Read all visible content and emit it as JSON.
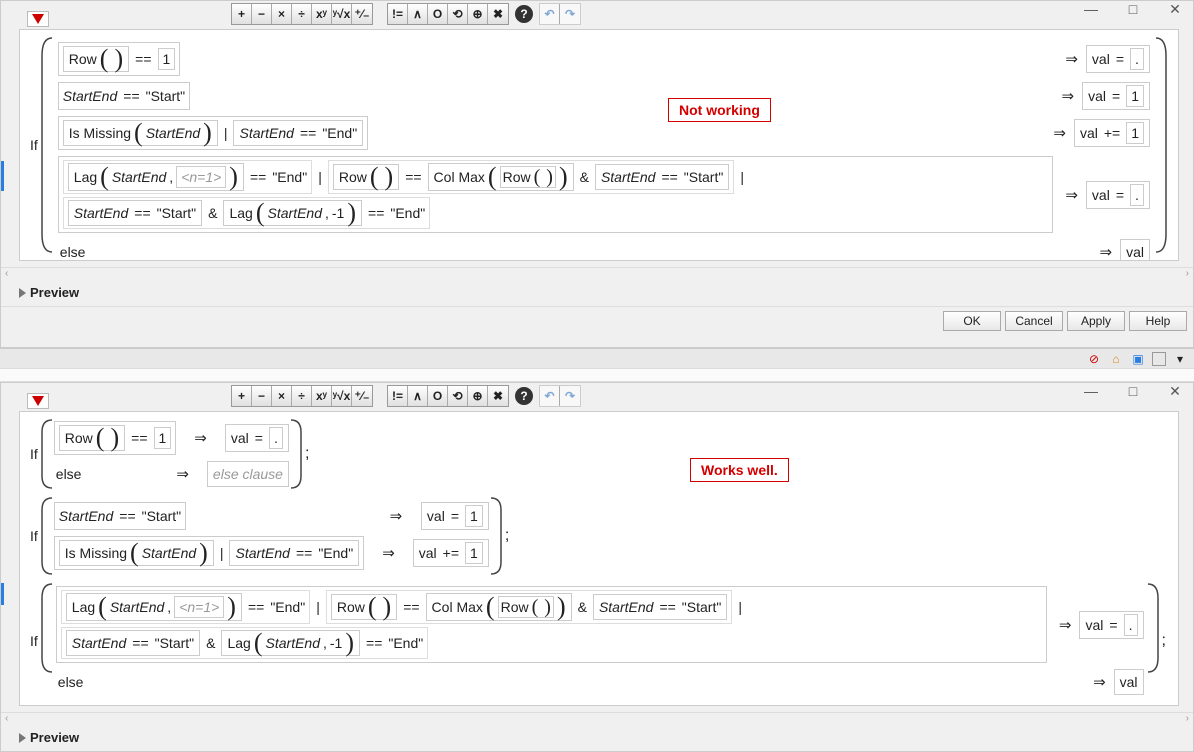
{
  "toolbar": {
    "ops": [
      "+",
      "−",
      "×",
      "÷",
      "xʸ",
      "ʸ√x",
      "⁺⁄₋"
    ],
    "cmp": [
      "!=",
      "∧",
      "Ο",
      "⟲",
      "⊕",
      "✖"
    ],
    "help": "?",
    "undo": "↶",
    "redo": "↷"
  },
  "annotations": {
    "top": "Not working",
    "bottom": "Works well."
  },
  "tokens": {
    "if": "If",
    "else": "else",
    "row": "Row",
    "startend": "StartEnd",
    "ismissing": "Is Missing",
    "lag": "Lag",
    "colmax": "Col Max",
    "val": "val",
    "eq": "==",
    "assign": "=",
    "plus_assign": "+=",
    "one": "1",
    "neg_one": "-1",
    "dot": ".",
    "n1": "<n=1>",
    "start_str": "\"Start\"",
    "end_str": "\"End\"",
    "else_clause": "else clause",
    "pipe": "|",
    "amp": "&"
  },
  "preview": "Preview",
  "buttons": {
    "ok": "OK",
    "cancel": "Cancel",
    "apply": "Apply",
    "help": "Help"
  }
}
